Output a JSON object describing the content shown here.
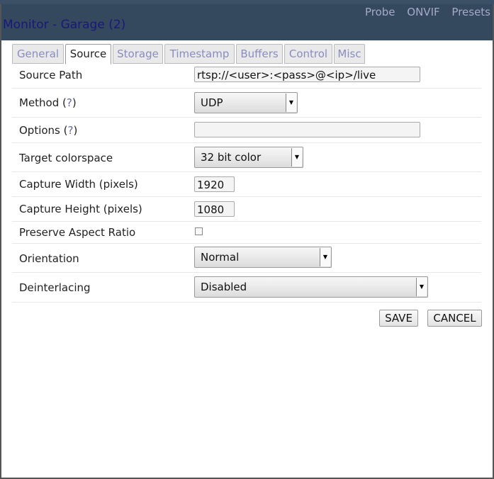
{
  "window": {
    "title": "Monitor - Garage (2)",
    "links": [
      "Probe",
      "ONVIF",
      "Presets"
    ]
  },
  "tabs": [
    {
      "label": "General",
      "active": false
    },
    {
      "label": "Source",
      "active": true
    },
    {
      "label": "Storage",
      "active": false
    },
    {
      "label": "Timestamp",
      "active": false
    },
    {
      "label": "Buffers",
      "active": false
    },
    {
      "label": "Control",
      "active": false
    },
    {
      "label": "Misc",
      "active": false
    }
  ],
  "form": {
    "source_path": {
      "label": "Source Path",
      "value": "rtsp://<user>:<pass>@<ip>/live"
    },
    "method": {
      "label": "Method (",
      "help": "?",
      "close": ")",
      "value": "UDP"
    },
    "options": {
      "label": "Options (",
      "help": "?",
      "close": ")",
      "value": ""
    },
    "colorspace": {
      "label": "Target colorspace",
      "value": "32 bit color"
    },
    "capture_width": {
      "label": "Capture Width (pixels)",
      "value": "1920"
    },
    "capture_height": {
      "label": "Capture Height (pixels)",
      "value": "1080"
    },
    "preserve_aspect": {
      "label": "Preserve Aspect Ratio",
      "checked": false
    },
    "orientation": {
      "label": "Orientation",
      "value": "Normal"
    },
    "deinterlacing": {
      "label": "Deinterlacing",
      "value": "Disabled"
    }
  },
  "buttons": {
    "save": "SAVE",
    "cancel": "CANCEL"
  }
}
